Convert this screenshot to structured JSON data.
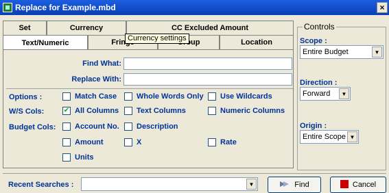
{
  "window": {
    "title": "Replace for Example.mbd",
    "close_glyph": "×"
  },
  "tabs_row1": [
    "Set",
    "Currency",
    "CC Excluded Amount"
  ],
  "tabs_row2": [
    "Text/Numeric",
    "Fringe",
    "Group",
    "Location"
  ],
  "tooltip": "Currency settings",
  "fields": {
    "find_label": "Find What:",
    "find_value": "",
    "replace_label": "Replace With:",
    "replace_value": ""
  },
  "options": {
    "label": "Options :",
    "match_case": "Match Case",
    "whole_words": "Whole Words Only",
    "use_wildcards": "Use Wildcards"
  },
  "ws_cols": {
    "label": "W/S Cols:",
    "all_columns": "All Columns",
    "text_columns": "Text Columns",
    "numeric_columns": "Numeric Columns",
    "all_columns_checked": true
  },
  "budget_cols": {
    "label": "Budget Cols:",
    "account_no": "Account No.",
    "description": "Description",
    "amount": "Amount",
    "x": "X",
    "rate": "Rate",
    "units": "Units"
  },
  "controls": {
    "legend": "Controls",
    "scope_label": "Scope :",
    "scope_value": "Entire Budget",
    "direction_label": "Direction :",
    "direction_value": "Forward",
    "origin_label": "Origin :",
    "origin_value": "Entire Scope"
  },
  "bottom": {
    "recent_label": "Recent Searches :",
    "recent_value": "",
    "find_button": "Find",
    "cancel_button": "Cancel"
  },
  "checkmark": "✔",
  "arrow_glyph": "▼",
  "colors": {
    "label_blue": "#003399",
    "title_bar": "#0a3fb5",
    "cancel_red": "#cc0000"
  }
}
